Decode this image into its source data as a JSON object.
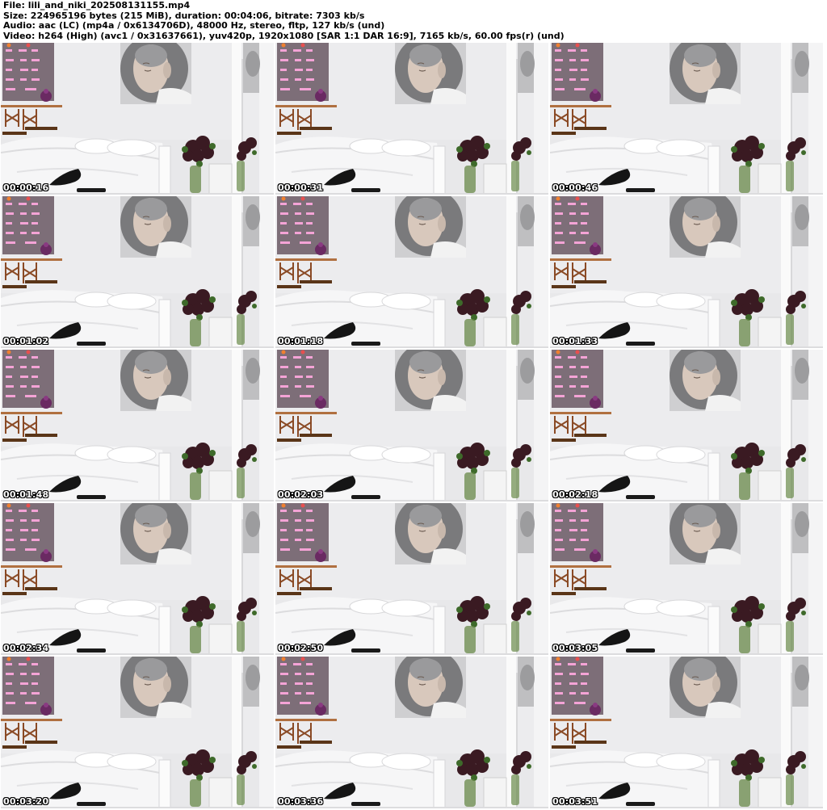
{
  "header": {
    "file_line": "File: lili_and_niki_202508131155.mp4",
    "size_line": "Size: 224965196 bytes (215 MiB), duration: 00:04:06, bitrate: 7303 kb/s",
    "audio_line": "Audio: aac (LC) (mp4a / 0x6134706D), 48000 Hz, stereo, fltp, 127 kb/s (und)",
    "video_line": "Video: h264 (High) (avc1 / 0x31637661), yuv420p, 1920x1080 [SAR 1:1 DAR 16:9], 7165 kb/s, 60.00 fps(r) (und)"
  },
  "thumbnails": [
    {
      "timestamp": "00:00:16"
    },
    {
      "timestamp": "00:00:31"
    },
    {
      "timestamp": "00:00:46"
    },
    {
      "timestamp": "00:01:02"
    },
    {
      "timestamp": "00:01:18"
    },
    {
      "timestamp": "00:01:33"
    },
    {
      "timestamp": "00:01:48"
    },
    {
      "timestamp": "00:02:03"
    },
    {
      "timestamp": "00:02:18"
    },
    {
      "timestamp": "00:02:34"
    },
    {
      "timestamp": "00:02:50"
    },
    {
      "timestamp": "00:03:05"
    },
    {
      "timestamp": "00:03:20"
    },
    {
      "timestamp": "00:03:36"
    },
    {
      "timestamp": "00:03:51"
    }
  ]
}
